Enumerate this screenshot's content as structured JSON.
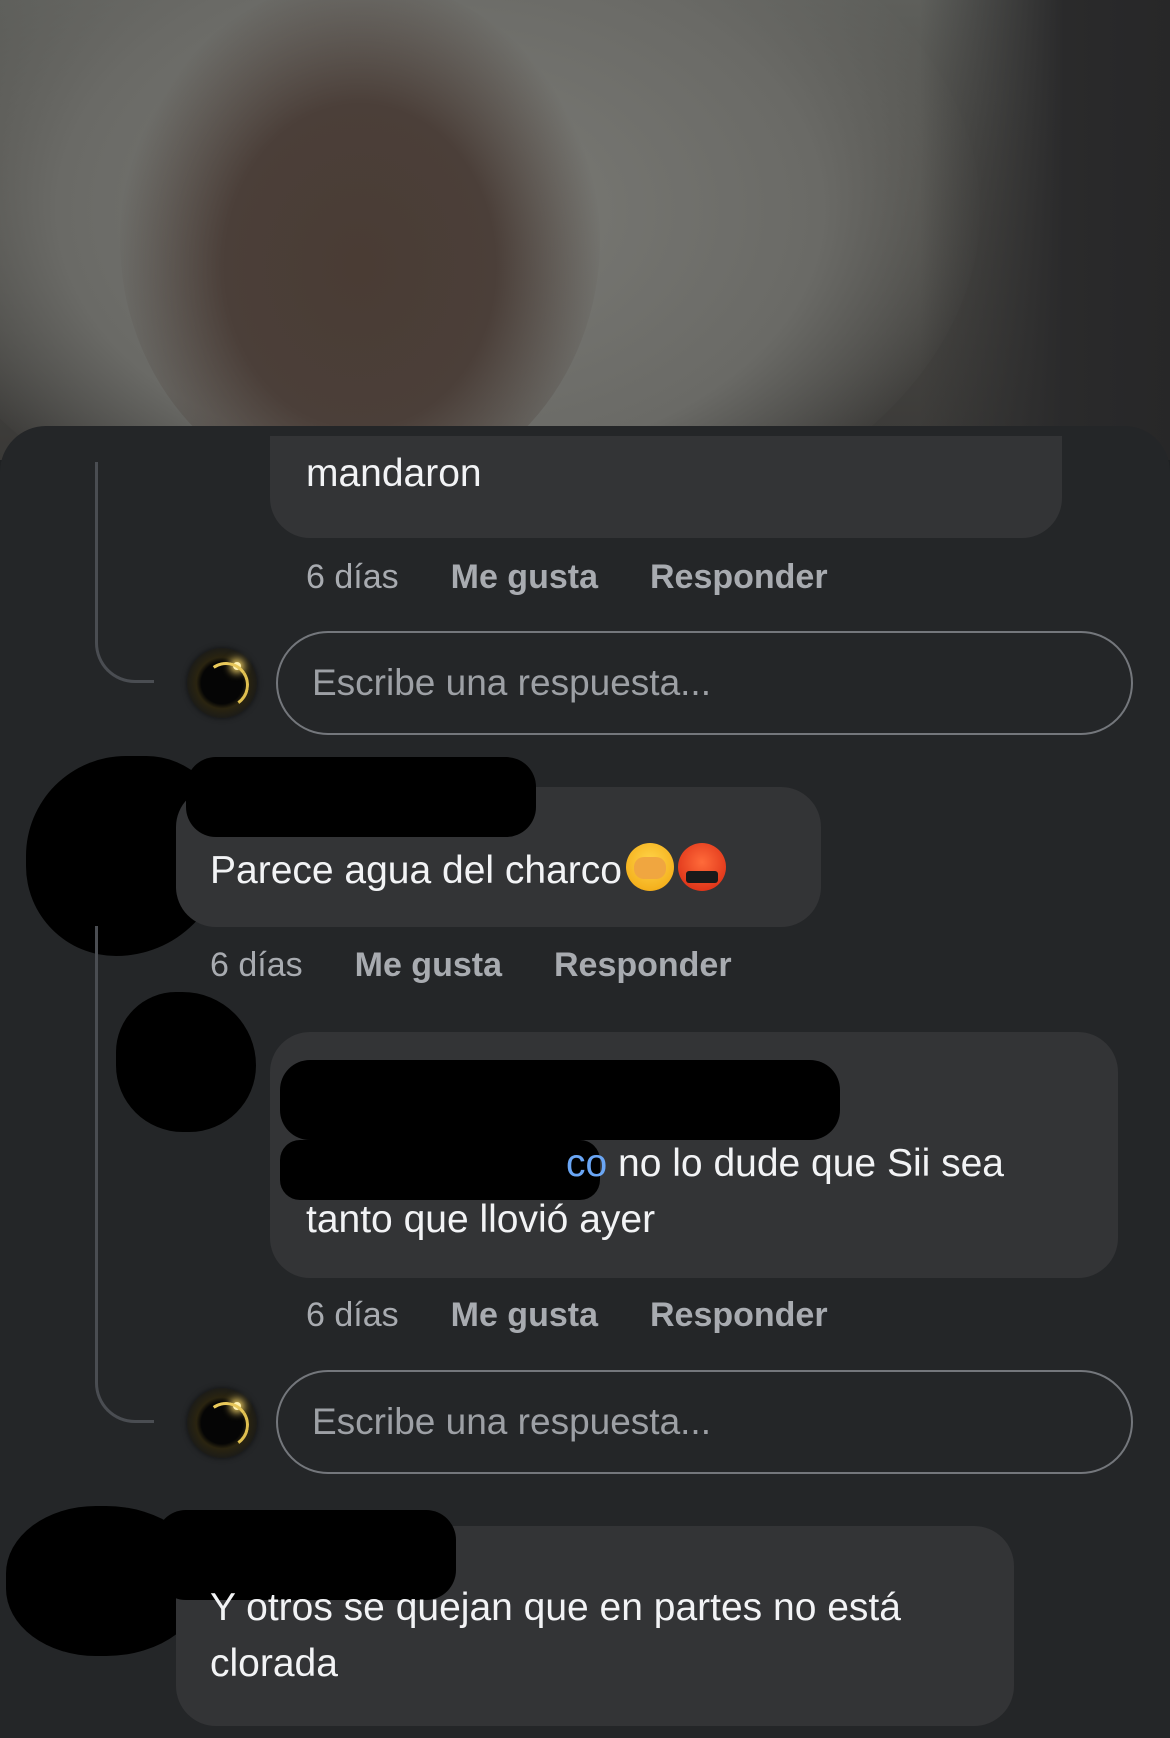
{
  "comments": [
    {
      "text": "mandaron",
      "time": "6 días",
      "like_label": "Me gusta",
      "reply_label": "Responder"
    },
    {
      "text": "Parece agua del charco",
      "emojis": [
        "hands-over-face-emoji",
        "cursing-face-emoji"
      ],
      "time": "6 días",
      "like_label": "Me gusta",
      "reply_label": "Responder"
    },
    {
      "mention": "co",
      "text_line1": " no lo dude que Sii sea",
      "text_line2": "tanto que llovió ayer",
      "time": "6 días",
      "like_label": "Me gusta",
      "reply_label": "Responder"
    },
    {
      "text_line1": "Y otros se quejan que en partes no está",
      "text_line2": "clorada"
    }
  ],
  "reply_inputs": [
    {
      "placeholder": "Escribe una respuesta..."
    },
    {
      "placeholder": "Escribe una respuesta..."
    }
  ],
  "colors": {
    "sheet_bg": "#242628",
    "bubble_bg": "#333436",
    "mention": "#6aa6f5",
    "meta_text": "#a8abb0"
  }
}
